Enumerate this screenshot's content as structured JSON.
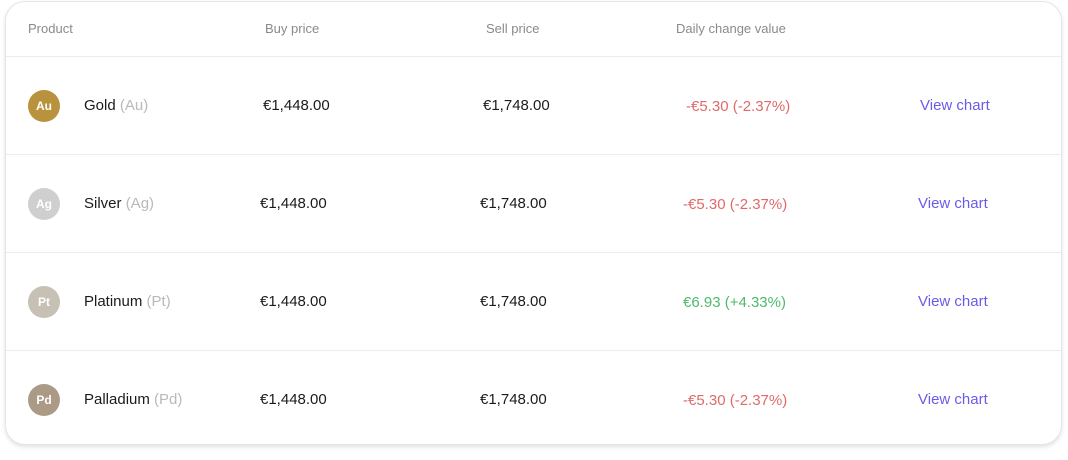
{
  "table": {
    "headers": {
      "product": "Product",
      "buy_price": "Buy price",
      "sell_price": "Sell price",
      "daily_change": "Daily change value"
    },
    "rows": [
      {
        "avatar": "Au",
        "avatar_color": "#b8923c",
        "name": "Gold",
        "symbol": "(Au)",
        "buy": "€1,448.00",
        "sell": "€1,748.00",
        "change": "-€5.30 (-2.37%)",
        "change_color": "#e06a6a",
        "action": "View chart"
      },
      {
        "avatar": "Ag",
        "avatar_color": "#cfcfcf",
        "name": "Silver",
        "symbol": "(Ag)",
        "buy": "€1,448.00",
        "sell": "€1,748.00",
        "change": "-€5.30 (-2.37%)",
        "change_color": "#e06a6a",
        "action": "View chart"
      },
      {
        "avatar": "Pt",
        "avatar_color": "#c7c1b5",
        "name": "Platinum",
        "symbol": "(Pt)",
        "buy": "€1,448.00",
        "sell": "€1,748.00",
        "change": "€6.93 (+4.33%)",
        "change_color": "#4fb96c",
        "action": "View chart"
      },
      {
        "avatar": "Pd",
        "avatar_color": "#ab9a86",
        "name": "Palladium",
        "symbol": "(Pd)",
        "buy": "€1,448.00",
        "sell": "€1,748.00",
        "change": "-€5.30 (-2.37%)",
        "change_color": "#e06a6a",
        "action": "View chart"
      }
    ]
  }
}
